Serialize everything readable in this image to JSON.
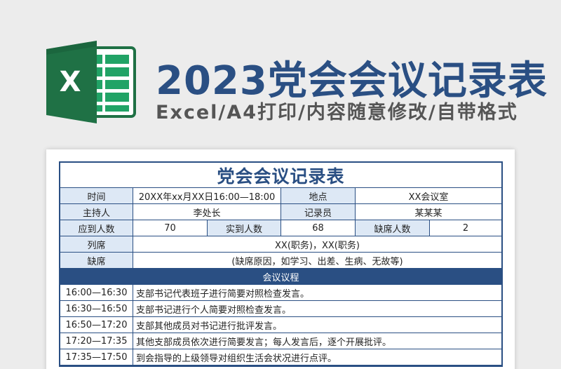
{
  "banner": {
    "logo_letter": "X",
    "title": "2023党会会议记录表",
    "subtitle": "Excel/A4打印/内容随意修改/自带格式"
  },
  "colors": {
    "primary": "#2a4f83",
    "label_bg": "#dde8f5",
    "excel_green": "#1f7145",
    "excel_green_dark": "#185c37"
  },
  "form": {
    "title": "党会会议记录表",
    "time_label": "时间",
    "time_value": "20XX年xx月XX日16:00—18:00",
    "place_label": "地点",
    "place_value": "XX会议室",
    "host_label": "主持人",
    "host_value": "李处长",
    "recorder_label": "记录员",
    "recorder_value": "某某某",
    "expected_label": "应到人数",
    "expected_value": "70",
    "actual_label": "实到人数",
    "actual_value": "68",
    "absent_count_label": "缺席人数",
    "absent_count_value": "2",
    "attendees_label": "列席",
    "attendees_value": "XX(职务)，XX(职务)",
    "absent_label": "缺席",
    "absent_value": "(缺席原因，如学习、出差、生病、无故等)",
    "agenda_title": "会议议程",
    "agenda": [
      {
        "time": "16:00—16:30",
        "desc": "支部书记代表班子进行简要对照检查发言。"
      },
      {
        "time": "16:30—16:50",
        "desc": "支部书记进行个人简要对照检查发言。"
      },
      {
        "time": "16:50—17:20",
        "desc": "支部其他成员对书记进行批评发言。"
      },
      {
        "time": "17:20—17:35",
        "desc": "其他支部成员依次进行简要发言；每人发言后，逐个开展批评。"
      },
      {
        "time": "17:35—17:50",
        "desc": "到会指导的上级领导对组织生活会状况进行点评。"
      }
    ]
  }
}
